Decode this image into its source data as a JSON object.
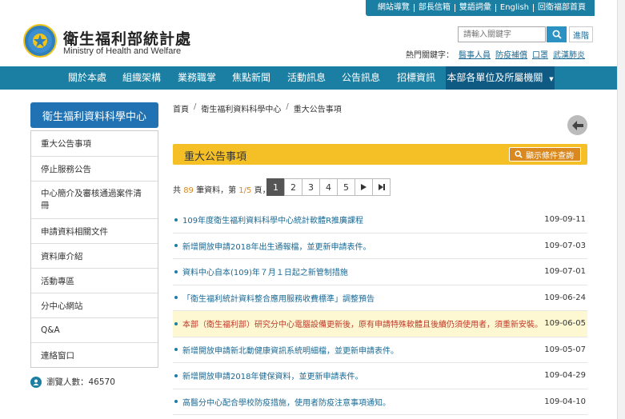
{
  "topbar": {
    "links": [
      "網站導覽",
      "部長信箱",
      "雙語詞彙",
      "English",
      "回衛福部首頁"
    ]
  },
  "header": {
    "title": "衛生福利部統計處",
    "subtitle": "Ministry of Health and Welfare",
    "search_placeholder": "請輸入關鍵字",
    "advanced_label": "進階",
    "hot_label": "熱門關鍵字：",
    "hot_keywords": [
      "醫事人員",
      "防疫補償",
      "口罩",
      "武漢肺炎"
    ]
  },
  "nav": {
    "items": [
      "關於本處",
      "組織架構",
      "業務職掌",
      "焦點新聞",
      "活動訊息",
      "公告訊息",
      "招標資訊",
      "本部各單位及所屬機關"
    ]
  },
  "sidebar": {
    "heading": "衛生福利資料科學中心",
    "items": [
      "重大公告事項",
      "停止服務公告",
      "中心簡介及審核通過案件清冊",
      "申請資料相關文件",
      "資料庫介紹",
      "活動專區",
      "分中心網站",
      "Q&A",
      "連絡窗口"
    ],
    "visitors_label": "瀏覽人數：",
    "visitors_count": "46570"
  },
  "breadcrumb": [
    "首頁",
    "衛生福利資料科學中心",
    "重大公告事項"
  ],
  "main": {
    "section_title": "重大公告事項",
    "filter_label": "顯示條件查詢",
    "pager_prefix": "共",
    "total": "89",
    "pager_mid": "筆資料，第",
    "page": "1/5",
    "pager_suffix": "頁，",
    "pages": [
      "1",
      "2",
      "3",
      "4",
      "5"
    ]
  },
  "news": [
    {
      "title": "109年度衛生福利資料科學中心統計軟體R推廣課程",
      "date": "109-09-11"
    },
    {
      "title": "新增開放申請2018年出生通報檔，並更新申請表件。",
      "date": "109-07-03"
    },
    {
      "title": "資料中心自本(109)年７月１日起之新管制措施",
      "date": "109-07-01"
    },
    {
      "title": "「衛生福利統計資料整合應用服務收費標準」調整預告",
      "date": "109-06-24"
    },
    {
      "title": "本部（衛生福利部）研究分中心電腦設備更新後，原有申請特殊軟體且後續仍須使用者，須重新安裝。",
      "date": "109-06-05"
    },
    {
      "title": "新增開放申請新北動健康資訊系統明細檔，並更新申請表件。",
      "date": "109-05-07"
    },
    {
      "title": "新增開放申請2018年健保資料，並更新申請表件。",
      "date": "109-04-29"
    },
    {
      "title": "高醫分中心配合學校防疫措施，使用者防疫注意事項通知。",
      "date": "109-04-10"
    }
  ]
}
